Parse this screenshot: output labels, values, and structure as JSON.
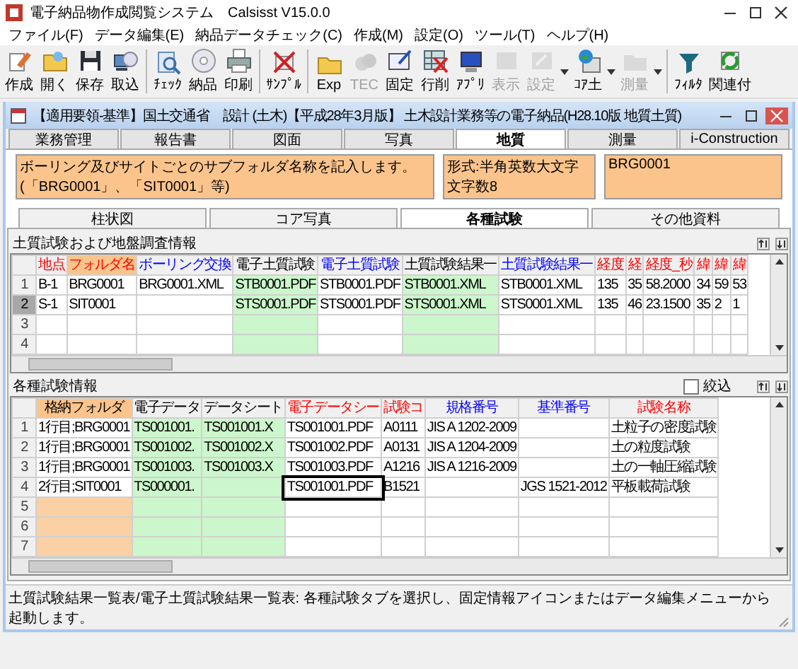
{
  "window": {
    "title": "電子納品物作成閲覧システム　Calsisst V15.0.0"
  },
  "menu": [
    {
      "label": "ファイル(F)"
    },
    {
      "label": "データ編集(E)"
    },
    {
      "label": "納品データチェック(C)"
    },
    {
      "label": "作成(M)"
    },
    {
      "label": "設定(O)"
    },
    {
      "label": "ツール(T)"
    },
    {
      "label": "ヘルプ(H)"
    }
  ],
  "toolbar": [
    {
      "kind": "button",
      "label": "作成",
      "disabled": false
    },
    {
      "kind": "button",
      "label": "開く",
      "disabled": false
    },
    {
      "kind": "button",
      "label": "保存",
      "disabled": false
    },
    {
      "kind": "button",
      "label": "取込",
      "disabled": false
    },
    {
      "kind": "separator"
    },
    {
      "kind": "button",
      "label": "ﾁｪｯｸ",
      "disabled": false
    },
    {
      "kind": "button",
      "label": "納品",
      "disabled": false
    },
    {
      "kind": "button",
      "label": "印刷",
      "disabled": false
    },
    {
      "kind": "separator"
    },
    {
      "kind": "button",
      "label": "ｻﾝﾌﾟﾙ",
      "disabled": false
    },
    {
      "kind": "separator"
    },
    {
      "kind": "button",
      "label": "Exp",
      "disabled": false
    },
    {
      "kind": "button",
      "label": "TEC",
      "disabled": true
    },
    {
      "kind": "button",
      "label": "固定",
      "disabled": false
    },
    {
      "kind": "button",
      "label": "行削",
      "disabled": false
    },
    {
      "kind": "button",
      "label": "ｱﾌﾟﾘ",
      "disabled": false
    },
    {
      "kind": "button",
      "label": "表示",
      "disabled": true
    },
    {
      "kind": "button",
      "label": "設定",
      "disabled": true
    },
    {
      "kind": "dropdown"
    },
    {
      "kind": "button",
      "label": "ｺｱ土",
      "disabled": false
    },
    {
      "kind": "dropdown"
    },
    {
      "kind": "button",
      "label": "測量",
      "disabled": true
    },
    {
      "kind": "dropdown"
    },
    {
      "kind": "separator"
    },
    {
      "kind": "button",
      "label": "ﾌｨﾙﾀ",
      "disabled": false
    },
    {
      "kind": "button",
      "label": "関連付",
      "disabled": false
    }
  ],
  "document_window": {
    "title": "【適用要領-基準】国土交通省　設計 (土木)【平成28年3月版】 土木設計業務等の電子納品(H28.10版 地質土質)"
  },
  "tabs": [
    {
      "label": "業務管理",
      "selected": false
    },
    {
      "label": "報告書",
      "selected": false
    },
    {
      "label": "図面",
      "selected": false
    },
    {
      "label": "写真",
      "selected": false
    },
    {
      "label": "地質",
      "selected": true
    },
    {
      "label": "測量",
      "selected": false
    },
    {
      "label": "i-Construction",
      "selected": false
    }
  ],
  "info": {
    "description": "ボーリング及びサイトごとのサブフォルダ名称を記入します。(「BRG0001」、「SIT0001」等)",
    "format": [
      "形式:半角英数大文字",
      "文字数8"
    ],
    "value": "BRG0001"
  },
  "sub_tabs": [
    {
      "label": "柱状図",
      "selected": false
    },
    {
      "label": "コア写真",
      "selected": false
    },
    {
      "label": "各種試験",
      "selected": true
    },
    {
      "label": "その他資料",
      "selected": false
    }
  ],
  "survey_table": {
    "title": "土質試験および地盤調査情報",
    "columns": [
      {
        "label": "地点",
        "color": "#ff0000",
        "selected": false
      },
      {
        "label": "フォルダ名",
        "color": "#ff0000",
        "selected": true
      },
      {
        "label": "ボーリング交換",
        "color": "#0000ff",
        "selected": false
      },
      {
        "label": "電子土質試験",
        "color": "#000000",
        "selected": false,
        "kind": "file"
      },
      {
        "label": "電子土質試験",
        "color": "#0000ff",
        "selected": false
      },
      {
        "label": "土質試験結果一",
        "color": "#000000",
        "selected": false,
        "kind": "file"
      },
      {
        "label": "土質試験結果一",
        "color": "#0000ff",
        "selected": false
      },
      {
        "label": "経度",
        "color": "#ff0000",
        "selected": false
      },
      {
        "label": "経",
        "color": "#ff0000",
        "selected": false
      },
      {
        "label": "経度_秒",
        "color": "#ff0000",
        "selected": false
      },
      {
        "label": "緯",
        "color": "#ff0000",
        "selected": false
      },
      {
        "label": "緯",
        "color": "#ff0000",
        "selected": false
      },
      {
        "label": "緯",
        "color": "#ff0000",
        "selected": false
      }
    ],
    "rows": [
      {
        "number": "1",
        "selected": false,
        "cells": [
          "B-1",
          "BRG0001",
          "BRG0001.XML",
          "STB0001.PDF",
          "STB0001.PDF",
          "STB0001.XML",
          "STB0001.XML",
          "135",
          "35",
          "58.2000",
          "34",
          "59",
          "53"
        ]
      },
      {
        "number": "2",
        "selected": true,
        "cells": [
          "S-1",
          "SIT0001",
          null,
          "STS0001.PDF",
          "STS0001.PDF",
          "STS0001.XML",
          "STS0001.XML",
          "135",
          "46",
          "23.1500",
          "35",
          "2",
          "1"
        ]
      },
      {
        "number": "3",
        "selected": false
      },
      {
        "number": "4",
        "selected": false
      }
    ]
  },
  "test_table": {
    "title": "各種試験情報",
    "filter": {
      "label": "絞込",
      "checked": false
    },
    "columns": [
      {
        "label": "格納フォルダ",
        "color": "#000000",
        "selected": true
      },
      {
        "label": "電子データ",
        "color": "#000000",
        "selected": false,
        "kind": "file"
      },
      {
        "label": "データシート",
        "color": "#000000",
        "selected": false,
        "kind": "file"
      },
      {
        "label": "電子データシー",
        "color": "#ff0000",
        "selected": false,
        "focused": true
      },
      {
        "label": "試験コ",
        "color": "#ff0000",
        "selected": false
      },
      {
        "label": "規格番号",
        "color": "#0000ff",
        "selected": false
      },
      {
        "label": "基準番号",
        "color": "#0000ff",
        "selected": false
      },
      {
        "label": "試験名称",
        "color": "#ff0000",
        "selected": false
      }
    ],
    "rows": [
      {
        "number": "1",
        "selected": false,
        "cells": [
          "1行目;BRG0001",
          "TS001001.",
          "TS001001.X",
          "TS001001.PDF",
          "A0111",
          "JIS A 1202-2009",
          null,
          "土粒子の密度試験"
        ]
      },
      {
        "number": "2",
        "selected": false,
        "cells": [
          "1行目;BRG0001",
          "TS001002.",
          "TS001002.X",
          "TS001002.PDF",
          "A0131",
          "JIS A 1204-2009",
          null,
          "土の粒度試験"
        ]
      },
      {
        "number": "3",
        "selected": false,
        "cells": [
          "1行目;BRG0001",
          "TS001003.",
          "TS001003.X",
          "TS001003.PDF",
          "A1216",
          "JIS A 1216-2009",
          null,
          "土の一軸圧縮試験"
        ]
      },
      {
        "number": "4",
        "selected": false,
        "focused": true,
        "cells": [
          "2行目;SIT0001",
          "TS000001.",
          null,
          "TS001001.PDF",
          "B1521",
          null,
          "JGS 1521-2012",
          "平板載荷試験"
        ]
      },
      {
        "number": "5",
        "selected": false,
        "pending": true
      },
      {
        "number": "6",
        "selected": false,
        "pending": true
      },
      {
        "number": "7",
        "selected": false,
        "pending": true
      }
    ]
  },
  "status_bar": {
    "text": "土質試験結果一覧表/電子土質試験結果一覧表: 各種試験タブを選択し、固定情報アイコンまたはデータ編集メニューから起動します。"
  }
}
